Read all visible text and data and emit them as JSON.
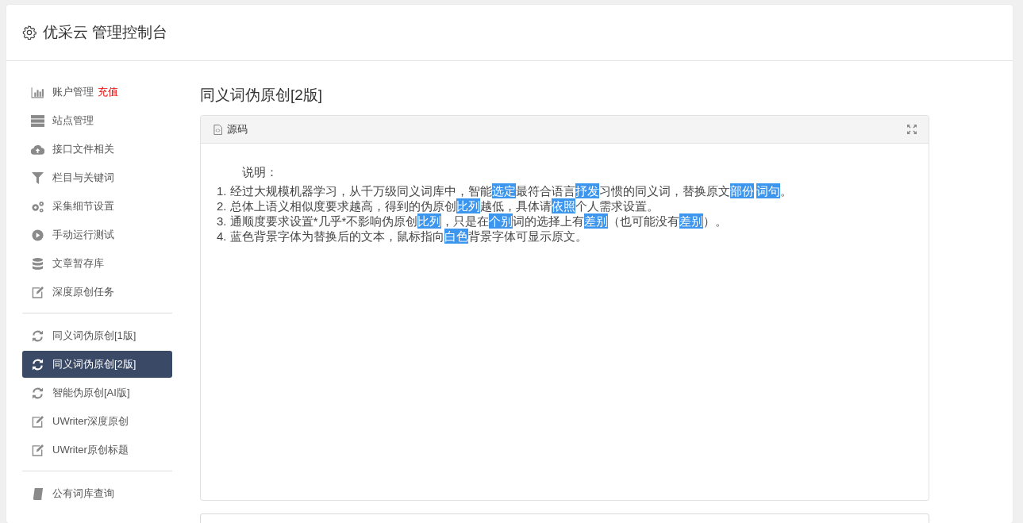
{
  "header": {
    "title": "优采云 管理控制台"
  },
  "sidebar": {
    "groups": [
      [
        {
          "label": "账户管理",
          "badge": "充值",
          "selected": false
        },
        {
          "label": "站点管理",
          "selected": false
        },
        {
          "label": "接口文件相关",
          "selected": false
        },
        {
          "label": "栏目与关键词",
          "selected": false
        },
        {
          "label": "采集细节设置",
          "selected": false
        },
        {
          "label": "手动运行测试",
          "selected": false
        },
        {
          "label": "文章暂存库",
          "selected": false
        },
        {
          "label": "深度原创任务",
          "selected": false
        }
      ],
      [
        {
          "label": "同义词伪原创[1版]",
          "selected": false
        },
        {
          "label": "同义词伪原创[2版]",
          "selected": true
        },
        {
          "label": "智能伪原创[AI版]",
          "selected": false
        },
        {
          "label": "UWriter深度原创",
          "selected": false
        },
        {
          "label": "UWriter原创标题",
          "selected": false
        }
      ],
      [
        {
          "label": "公有词库查询",
          "selected": false
        }
      ]
    ]
  },
  "page_title": "同义词伪原创[2版]",
  "source_panel": {
    "title": "源码",
    "heading": "说明：",
    "lines": [
      [
        {
          "text": "1. 经过大规模机器学习，从千万级同义词库中，智能",
          "highlighted": false
        },
        {
          "text": "选定",
          "highlighted": true
        },
        {
          "text": "最符合语言",
          "highlighted": false
        },
        {
          "text": "抒发",
          "highlighted": true
        },
        {
          "text": "习惯的同义词，替换原文",
          "highlighted": false
        },
        {
          "text": "部份",
          "highlighted": true
        },
        {
          "text": "词句",
          "highlighted": true
        },
        {
          "text": "。",
          "highlighted": false
        }
      ],
      [
        {
          "text": "2. 总体上语义相似度要求越高，得到的伪原创",
          "highlighted": false
        },
        {
          "text": "比列",
          "highlighted": true
        },
        {
          "text": "越低，具体请",
          "highlighted": false
        },
        {
          "text": "依照",
          "highlighted": true
        },
        {
          "text": "个人需求设置。",
          "highlighted": false
        }
      ],
      [
        {
          "text": "3. 通顺度要求设置*几乎*不影响伪原创",
          "highlighted": false
        },
        {
          "text": "比列",
          "highlighted": true
        },
        {
          "text": "，只是在",
          "highlighted": false
        },
        {
          "text": "个别",
          "highlighted": true
        },
        {
          "text": "词的选择上有",
          "highlighted": false
        },
        {
          "text": "差别",
          "highlighted": true
        },
        {
          "text": "（也可能没有",
          "highlighted": false
        },
        {
          "text": "差别",
          "highlighted": true
        },
        {
          "text": "）。",
          "highlighted": false
        }
      ],
      [
        {
          "text": "4. 蓝色背景字体为替换后的文本，鼠标指向",
          "highlighted": false
        },
        {
          "text": "白色",
          "highlighted": true
        },
        {
          "text": "背景字体可显示原文。",
          "highlighted": false
        }
      ]
    ]
  }
}
